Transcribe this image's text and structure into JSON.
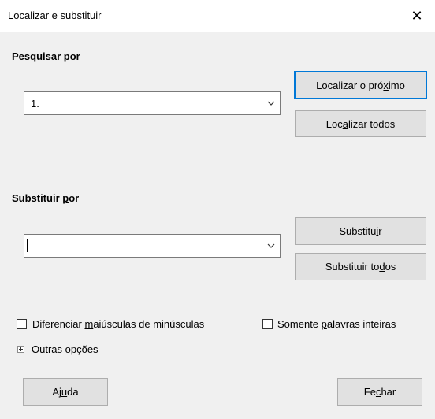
{
  "window": {
    "title": "Localizar e substituir"
  },
  "search": {
    "label_u": "P",
    "label_rest": "esquisar por",
    "value": "1."
  },
  "replace": {
    "label_a": "Substituir ",
    "label_u": "p",
    "label_b": "or",
    "value": ""
  },
  "buttons": {
    "find_next_a": "Localizar o pró",
    "find_next_u": "x",
    "find_next_b": "imo",
    "find_all_a": "Loc",
    "find_all_u": "a",
    "find_all_b": "lizar todos",
    "replace_a": "Substitu",
    "replace_u": "i",
    "replace_b": "r",
    "replace_all_a": "Substituir to",
    "replace_all_u": "d",
    "replace_all_b": "os",
    "help_a": "Aj",
    "help_u": "u",
    "help_b": "da",
    "close_a": "Fe",
    "close_u": "c",
    "close_b": "har"
  },
  "options": {
    "match_case_a": "Diferenciar ",
    "match_case_u": "m",
    "match_case_b": "aiúsculas de minúsculas",
    "match_case_checked": false,
    "whole_words_a": "Somente ",
    "whole_words_u": "p",
    "whole_words_b": "alavras inteiras",
    "whole_words_checked": false,
    "other_u": "O",
    "other_rest": "utras opções"
  },
  "icons": {
    "close": "close-icon",
    "dropdown": "chevron-down-icon",
    "expand": "plus-box-icon"
  },
  "colors": {
    "default_button_border": "#0078d7",
    "button_bg": "#e1e1e1"
  }
}
